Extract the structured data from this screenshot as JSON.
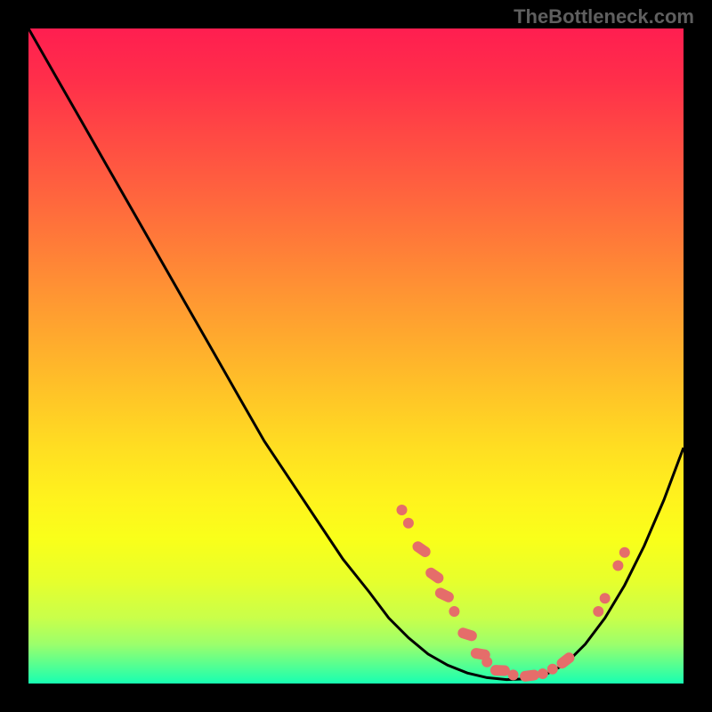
{
  "watermark": "TheBottleneck.com",
  "chart_data": {
    "type": "line",
    "title": "",
    "xlabel": "",
    "ylabel": "",
    "xlim": [
      0,
      100
    ],
    "ylim": [
      0,
      100
    ],
    "x": [
      0,
      4,
      8,
      12,
      16,
      20,
      24,
      28,
      32,
      36,
      40,
      44,
      48,
      52,
      55,
      58,
      61,
      64,
      67,
      70,
      73,
      76,
      79,
      82,
      85,
      88,
      91,
      94,
      97,
      100
    ],
    "values": [
      100,
      93,
      86,
      79,
      72,
      65,
      58,
      51,
      44,
      37,
      31,
      25,
      19,
      14,
      10,
      7,
      4.5,
      2.8,
      1.6,
      0.9,
      0.6,
      0.7,
      1.4,
      3,
      6,
      10,
      15,
      21,
      28,
      36
    ],
    "marker_points": [
      {
        "x": 57,
        "y": 26.5,
        "type": "dot"
      },
      {
        "x": 58,
        "y": 24.5,
        "type": "dot"
      },
      {
        "x": 60,
        "y": 20.5,
        "type": "elongated"
      },
      {
        "x": 62,
        "y": 16.5,
        "type": "elongated"
      },
      {
        "x": 63.5,
        "y": 13.5,
        "type": "elongated"
      },
      {
        "x": 65,
        "y": 11,
        "type": "dot"
      },
      {
        "x": 67,
        "y": 7.5,
        "type": "elongated"
      },
      {
        "x": 69,
        "y": 4.5,
        "type": "elongated"
      },
      {
        "x": 70,
        "y": 3.3,
        "type": "dot"
      },
      {
        "x": 72,
        "y": 2,
        "type": "elongated"
      },
      {
        "x": 74,
        "y": 1.3,
        "type": "dot"
      },
      {
        "x": 76.5,
        "y": 1.2,
        "type": "elongated"
      },
      {
        "x": 78.5,
        "y": 1.5,
        "type": "dot"
      },
      {
        "x": 80,
        "y": 2.2,
        "type": "dot"
      },
      {
        "x": 82,
        "y": 3.5,
        "type": "elongated"
      },
      {
        "x": 87,
        "y": 11,
        "type": "dot"
      },
      {
        "x": 88,
        "y": 13,
        "type": "dot"
      },
      {
        "x": 90,
        "y": 18,
        "type": "dot"
      },
      {
        "x": 91,
        "y": 20,
        "type": "dot"
      }
    ],
    "gradient_colors": {
      "top": "#ff1e50",
      "middle": "#ffde22",
      "bottom": "#17ffb2"
    },
    "background": "#000000"
  }
}
